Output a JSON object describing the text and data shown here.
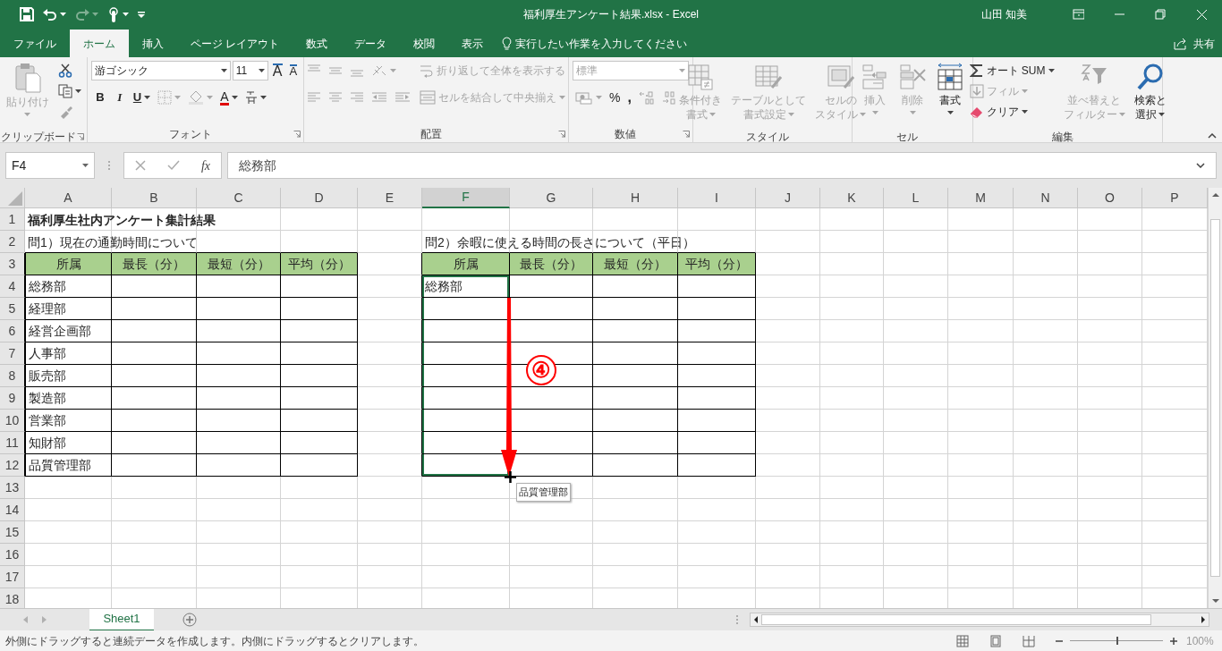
{
  "title_bar": {
    "title": "福利厚生アンケート結果.xlsx  -  Excel",
    "user": "山田 知美",
    "quick_access": [
      {
        "kind": "save",
        "disabled": false
      },
      {
        "kind": "undo",
        "disabled": false
      },
      {
        "kind": "redo",
        "disabled": true
      },
      {
        "kind": "touch",
        "disabled": false
      },
      {
        "kind": "customize",
        "disabled": false
      }
    ]
  },
  "menu_tabs": [
    {
      "label": "ファイル",
      "selected": false
    },
    {
      "label": "ホーム",
      "selected": true
    },
    {
      "label": "挿入",
      "selected": false
    },
    {
      "label": "ページ レイアウト",
      "selected": false
    },
    {
      "label": "数式",
      "selected": false
    },
    {
      "label": "データ",
      "selected": false
    },
    {
      "label": "校閲",
      "selected": false
    },
    {
      "label": "表示",
      "selected": false
    }
  ],
  "tell_me": {
    "placeholder": "実行したい作業を入力してください"
  },
  "share": {
    "label": "共有"
  },
  "ribbon": {
    "groups": [
      {
        "label": "クリップボード",
        "launcher": true,
        "columns": [
          [
            [
              {
                "kind": "paste",
                "label": "貼り付け",
                "caret": true,
                "disabled": true
              }
            ]
          ],
          [
            [
              {
                "kind": "cut",
                "caret": false,
                "disabled": false
              }
            ],
            [
              {
                "kind": "copy",
                "caret": true,
                "disabled": false
              }
            ],
            [
              {
                "kind": "brush",
                "caret": false,
                "disabled": true
              }
            ]
          ]
        ]
      },
      {
        "label": "フォント",
        "launcher": true,
        "columns": [
          [
            [
              {
                "kind": "font-box",
                "value": "游ゴシック",
                "disabled": false
              },
              {
                "kind": "size-box",
                "value": "11",
                "disabled": false
              },
              {
                "kind": "grow",
                "label": "A",
                "caret": false,
                "disabled": false
              },
              {
                "kind": "shrink",
                "label": "A",
                "caret": false,
                "disabled": false
              }
            ],
            [
              {
                "kind": "bold",
                "label": "B",
                "caret": false,
                "disabled": false
              },
              {
                "kind": "italic",
                "label": "I",
                "caret": false,
                "disabled": false
              },
              {
                "kind": "underline",
                "label": "U",
                "caret": true,
                "disabled": false
              },
              {
                "kind": "border",
                "caret": true,
                "disabled": true
              },
              {
                "kind": "fill",
                "caret": true,
                "disabled": true
              },
              {
                "kind": "fontcolor",
                "label": "A",
                "caret": true,
                "disabled": false
              },
              {
                "kind": "phonetic",
                "caret": true,
                "disabled": false
              }
            ]
          ]
        ]
      },
      {
        "label": "配置",
        "launcher": true,
        "columns": [
          [
            [
              {
                "kind": "align-top",
                "caret": false,
                "disabled": true
              },
              {
                "kind": "align-middle",
                "caret": false,
                "disabled": true
              },
              {
                "kind": "align-bottom",
                "caret": false,
                "disabled": true
              },
              {
                "kind": "orient",
                "caret": true,
                "disabled": true
              }
            ],
            [
              {
                "kind": "align-left",
                "caret": false,
                "disabled": true
              },
              {
                "kind": "align-center",
                "caret": false,
                "disabled": true
              },
              {
                "kind": "align-right",
                "caret": false,
                "disabled": true
              },
              {
                "kind": "outdent",
                "caret": false,
                "disabled": true
              },
              {
                "kind": "indent",
                "caret": false,
                "disabled": true
              }
            ]
          ],
          [
            [
              {
                "kind": "wrap",
                "label": "折り返して全体を表示する",
                "caret": false,
                "disabled": true
              }
            ],
            [
              {
                "kind": "merge",
                "label": "セルを結合して中央揃え",
                "caret": true,
                "disabled": true
              }
            ]
          ]
        ]
      },
      {
        "label": "数値",
        "launcher": true,
        "columns": [
          [
            [
              {
                "kind": "format-box",
                "value": "標準",
                "disabled": true
              }
            ],
            [
              {
                "kind": "currency",
                "caret": true,
                "disabled": true
              },
              {
                "kind": "percent",
                "label": "%",
                "caret": false,
                "disabled": false
              },
              {
                "kind": "comma",
                "label": ",",
                "caret": false,
                "disabled": false
              },
              {
                "kind": "inc-decimal",
                "caret": false,
                "disabled": true
              },
              {
                "kind": "dec-decimal",
                "caret": false,
                "disabled": true
              }
            ]
          ]
        ]
      },
      {
        "label": "スタイル",
        "launcher": false,
        "columns": [
          [
            [
              {
                "kind": "cond",
                "lines": [
                  "条件付き",
                  "書式"
                ],
                "caret": true,
                "disabled": true
              }
            ]
          ],
          [
            [
              {
                "kind": "table",
                "lines": [
                  "テーブルとして",
                  "書式設定"
                ],
                "caret": true,
                "disabled": true
              }
            ]
          ],
          [
            [
              {
                "kind": "styles",
                "lines": [
                  "セルの",
                  "スタイル"
                ],
                "caret": true,
                "disabled": true
              }
            ]
          ]
        ]
      },
      {
        "label": "セル",
        "launcher": false,
        "columns": [
          [
            [
              {
                "kind": "insert",
                "label": "挿入",
                "caret": true,
                "disabled": true
              }
            ]
          ],
          [
            [
              {
                "kind": "delete",
                "label": "削除",
                "caret": true,
                "disabled": true
              }
            ]
          ],
          [
            [
              {
                "kind": "format",
                "label": "書式",
                "caret": true,
                "disabled": false
              }
            ]
          ]
        ]
      },
      {
        "label": "編集",
        "launcher": false,
        "columns": [
          [
            [
              {
                "kind": "sum",
                "label": "オート SUM",
                "caret": true,
                "disabled": false
              }
            ],
            [
              {
                "kind": "fill-down",
                "label": "フィル",
                "caret": true,
                "disabled": true
              }
            ],
            [
              {
                "kind": "clear",
                "label": "クリア",
                "caret": true,
                "disabled": false
              }
            ]
          ],
          [
            [
              {
                "kind": "sort",
                "lines": [
                  "並べ替えと",
                  "フィルター"
                ],
                "caret": true,
                "disabled": true
              }
            ]
          ],
          [
            [
              {
                "kind": "find",
                "lines": [
                  "検索と",
                  "選択"
                ],
                "caret": true,
                "disabled": false
              }
            ]
          ]
        ]
      }
    ]
  },
  "formula_bar": {
    "name_box": "F4",
    "fx": "fx",
    "value": "総務部"
  },
  "sheet": {
    "columns": [
      {
        "label": "A",
        "selected": false
      },
      {
        "label": "B",
        "selected": false
      },
      {
        "label": "C",
        "selected": false
      },
      {
        "label": "D",
        "selected": false
      },
      {
        "label": "E",
        "selected": false
      },
      {
        "label": "F",
        "selected": true
      },
      {
        "label": "G",
        "selected": false
      },
      {
        "label": "H",
        "selected": false
      },
      {
        "label": "I",
        "selected": false
      },
      {
        "label": "J",
        "selected": false
      },
      {
        "label": "K",
        "selected": false
      },
      {
        "label": "L",
        "selected": false
      },
      {
        "label": "M",
        "selected": false
      },
      {
        "label": "N",
        "selected": false
      },
      {
        "label": "O",
        "selected": false
      },
      {
        "label": "P",
        "selected": false
      }
    ],
    "rows": [
      {
        "header": "1",
        "cells": [
          {
            "text": "福利厚生社内アンケート集計結果",
            "kind": "title",
            "selected": false
          },
          null,
          null,
          null,
          null,
          null,
          null,
          null,
          null,
          null,
          null,
          null,
          null,
          null,
          null,
          null
        ]
      },
      {
        "header": "2",
        "cells": [
          {
            "text": "問1）現在の通勤時間について",
            "kind": "plain",
            "selected": false
          },
          null,
          null,
          null,
          null,
          {
            "text": "問2）余暇に使える時間の長さについて（平日）",
            "kind": "plain",
            "selected": false
          },
          null,
          null,
          null,
          null,
          null,
          null,
          null,
          null,
          null,
          null
        ]
      },
      {
        "header": "3",
        "cells": [
          {
            "text": "所属",
            "kind": "header",
            "selected": false
          },
          {
            "text": "最長（分）",
            "kind": "header",
            "selected": false
          },
          {
            "text": "最短（分）",
            "kind": "header",
            "selected": false
          },
          {
            "text": "平均（分）",
            "kind": "header",
            "selected": false
          },
          null,
          {
            "text": "所属",
            "kind": "header",
            "selected": false
          },
          {
            "text": "最長（分）",
            "kind": "header",
            "selected": false
          },
          {
            "text": "最短（分）",
            "kind": "header",
            "selected": false
          },
          {
            "text": "平均（分）",
            "kind": "header",
            "selected": false
          },
          null,
          null,
          null,
          null,
          null,
          null,
          null
        ]
      },
      {
        "header": "4",
        "cells": [
          {
            "text": "総務部",
            "kind": "data",
            "selected": false
          },
          {
            "kind": "data",
            "selected": false
          },
          {
            "kind": "data",
            "selected": false
          },
          {
            "kind": "data",
            "selected": false
          },
          null,
          {
            "text": "総務部",
            "kind": "data",
            "selected": true
          },
          {
            "kind": "data",
            "selected": false
          },
          {
            "kind": "data",
            "selected": false
          },
          {
            "kind": "data",
            "selected": false
          },
          null,
          null,
          null,
          null,
          null,
          null,
          null
        ]
      },
      {
        "header": "5",
        "cells": [
          {
            "text": "経理部",
            "kind": "data",
            "selected": false
          },
          {
            "kind": "data",
            "selected": false
          },
          {
            "kind": "data",
            "selected": false
          },
          {
            "kind": "data",
            "selected": false
          },
          null,
          {
            "kind": "data",
            "selected": true
          },
          {
            "kind": "data",
            "selected": false
          },
          {
            "kind": "data",
            "selected": false
          },
          {
            "kind": "data",
            "selected": false
          },
          null,
          null,
          null,
          null,
          null,
          null,
          null
        ]
      },
      {
        "header": "6",
        "cells": [
          {
            "text": "経営企画部",
            "kind": "data",
            "selected": false
          },
          {
            "kind": "data",
            "selected": false
          },
          {
            "kind": "data",
            "selected": false
          },
          {
            "kind": "data",
            "selected": false
          },
          null,
          {
            "kind": "data",
            "selected": true
          },
          {
            "kind": "data",
            "selected": false
          },
          {
            "kind": "data",
            "selected": false
          },
          {
            "kind": "data",
            "selected": false
          },
          null,
          null,
          null,
          null,
          null,
          null,
          null
        ]
      },
      {
        "header": "7",
        "cells": [
          {
            "text": "人事部",
            "kind": "data",
            "selected": false
          },
          {
            "kind": "data",
            "selected": false
          },
          {
            "kind": "data",
            "selected": false
          },
          {
            "kind": "data",
            "selected": false
          },
          null,
          {
            "kind": "data",
            "selected": true
          },
          {
            "kind": "data",
            "selected": false
          },
          {
            "kind": "data",
            "selected": false
          },
          {
            "kind": "data",
            "selected": false
          },
          null,
          null,
          null,
          null,
          null,
          null,
          null
        ]
      },
      {
        "header": "8",
        "cells": [
          {
            "text": "販売部",
            "kind": "data",
            "selected": false
          },
          {
            "kind": "data",
            "selected": false
          },
          {
            "kind": "data",
            "selected": false
          },
          {
            "kind": "data",
            "selected": false
          },
          null,
          {
            "kind": "data",
            "selected": true
          },
          {
            "kind": "data",
            "selected": false
          },
          {
            "kind": "data",
            "selected": false
          },
          {
            "kind": "data",
            "selected": false
          },
          null,
          null,
          null,
          null,
          null,
          null,
          null
        ]
      },
      {
        "header": "9",
        "cells": [
          {
            "text": "製造部",
            "kind": "data",
            "selected": false
          },
          {
            "kind": "data",
            "selected": false
          },
          {
            "kind": "data",
            "selected": false
          },
          {
            "kind": "data",
            "selected": false
          },
          null,
          {
            "kind": "data",
            "selected": true
          },
          {
            "kind": "data",
            "selected": false
          },
          {
            "kind": "data",
            "selected": false
          },
          {
            "kind": "data",
            "selected": false
          },
          null,
          null,
          null,
          null,
          null,
          null,
          null
        ]
      },
      {
        "header": "10",
        "cells": [
          {
            "text": "営業部",
            "kind": "data",
            "selected": false
          },
          {
            "kind": "data",
            "selected": false
          },
          {
            "kind": "data",
            "selected": false
          },
          {
            "kind": "data",
            "selected": false
          },
          null,
          {
            "kind": "data",
            "selected": true
          },
          {
            "kind": "data",
            "selected": false
          },
          {
            "kind": "data",
            "selected": false
          },
          {
            "kind": "data",
            "selected": false
          },
          null,
          null,
          null,
          null,
          null,
          null,
          null
        ]
      },
      {
        "header": "11",
        "cells": [
          {
            "text": "知財部",
            "kind": "data",
            "selected": false
          },
          {
            "kind": "data",
            "selected": false
          },
          {
            "kind": "data",
            "selected": false
          },
          {
            "kind": "data",
            "selected": false
          },
          null,
          {
            "kind": "data",
            "selected": true
          },
          {
            "kind": "data",
            "selected": false
          },
          {
            "kind": "data",
            "selected": false
          },
          {
            "kind": "data",
            "selected": false
          },
          null,
          null,
          null,
          null,
          null,
          null,
          null
        ]
      },
      {
        "header": "12",
        "cells": [
          {
            "text": "品質管理部",
            "kind": "data",
            "selected": false
          },
          {
            "kind": "data",
            "selected": false
          },
          {
            "kind": "data",
            "selected": false
          },
          {
            "kind": "data",
            "selected": false
          },
          null,
          {
            "kind": "data",
            "selected": true
          },
          {
            "kind": "data",
            "selected": false
          },
          {
            "kind": "data",
            "selected": false
          },
          {
            "kind": "data",
            "selected": false
          },
          null,
          null,
          null,
          null,
          null,
          null,
          null
        ]
      },
      {
        "header": "13",
        "cells": [
          null,
          null,
          null,
          null,
          null,
          null,
          null,
          null,
          null,
          null,
          null,
          null,
          null,
          null,
          null,
          null
        ]
      },
      {
        "header": "14",
        "cells": [
          null,
          null,
          null,
          null,
          null,
          null,
          null,
          null,
          null,
          null,
          null,
          null,
          null,
          null,
          null,
          null
        ]
      },
      {
        "header": "15",
        "cells": [
          null,
          null,
          null,
          null,
          null,
          null,
          null,
          null,
          null,
          null,
          null,
          null,
          null,
          null,
          null,
          null
        ]
      },
      {
        "header": "16",
        "cells": [
          null,
          null,
          null,
          null,
          null,
          null,
          null,
          null,
          null,
          null,
          null,
          null,
          null,
          null,
          null,
          null
        ]
      },
      {
        "header": "17",
        "cells": [
          null,
          null,
          null,
          null,
          null,
          null,
          null,
          null,
          null,
          null,
          null,
          null,
          null,
          null,
          null,
          null
        ]
      },
      {
        "header": "18",
        "cells": [
          null,
          null,
          null,
          null,
          null,
          null,
          null,
          null,
          null,
          null,
          null,
          null,
          null,
          null,
          null,
          null
        ]
      }
    ]
  },
  "annotation": {
    "step": "④",
    "tooltip": "品質管理部"
  },
  "sheet_tabs": [
    {
      "label": "Sheet1",
      "selected": true
    }
  ],
  "status_bar": {
    "message": "外側にドラッグすると連続データを作成します。内側にドラッグするとクリアします。",
    "zoom": {
      "level": 0.5,
      "reading": "100%"
    }
  }
}
